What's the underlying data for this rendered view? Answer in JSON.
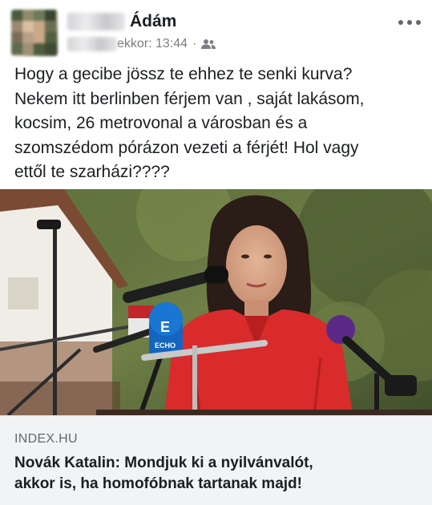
{
  "post": {
    "author_name_visible": "Ádám",
    "timestamp_suffix": "ekkor: 13:44",
    "separator": "·",
    "audience_icon": "friends-icon",
    "more_icon": "more-horizontal-icon",
    "text_lines": [
      "Hogy a gecibe jössz te ehhez te senki kurva?",
      "Nekem itt berlinben férjem van , saját lakásom,",
      "kocsim, 26 metrovonal a városban és a",
      "szomszédom pórázon vezeti a férjét! Hol vagy",
      "ettől te szarházi????"
    ]
  },
  "link": {
    "source": "INDEX.HU",
    "title_lines": [
      "Novák Katalin: Mondjuk ki a nyilvánvalót,",
      "akkor is, ha homofóbnak tartanak majd!"
    ],
    "image": {
      "mic_logo_text": "ECHO"
    }
  },
  "colors": {
    "text": "#1c1e21",
    "meta": "#7a7d82",
    "caption_bg": "#f2f3f5",
    "dress": "#d92b2b",
    "echo_blue": "#1565c0",
    "mic_purple": "#5b2a86"
  }
}
